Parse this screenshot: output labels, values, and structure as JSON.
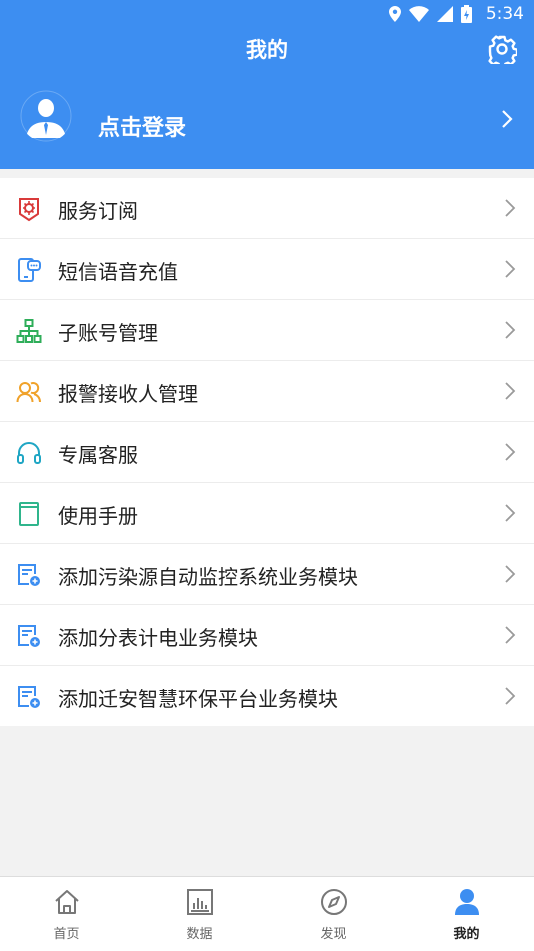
{
  "status_bar": {
    "time": "5:34"
  },
  "header": {
    "title": "我的",
    "login_text": "点击登录"
  },
  "menu": [
    {
      "label": "服务订阅",
      "icon": "subscribe-icon"
    },
    {
      "label": "短信语音充值",
      "icon": "sms-phone-icon"
    },
    {
      "label": "子账号管理",
      "icon": "org-tree-icon"
    },
    {
      "label": "报警接收人管理",
      "icon": "people-icon"
    },
    {
      "label": "专属客服",
      "icon": "headphones-icon"
    },
    {
      "label": "使用手册",
      "icon": "book-icon"
    },
    {
      "label": "添加污染源自动监控系统业务模块",
      "icon": "add-doc-icon"
    },
    {
      "label": "添加分表计电业务模块",
      "icon": "add-doc-icon"
    },
    {
      "label": "添加迁安智慧环保平台业务模块",
      "icon": "add-doc-icon"
    }
  ],
  "tabbar": [
    {
      "label": "首页",
      "icon": "home-icon"
    },
    {
      "label": "数据",
      "icon": "chart-icon"
    },
    {
      "label": "发现",
      "icon": "compass-icon"
    },
    {
      "label": "我的",
      "icon": "person-icon",
      "active": true
    }
  ],
  "colors": {
    "primary": "#3d8ef1",
    "background": "#f2f2f2"
  }
}
